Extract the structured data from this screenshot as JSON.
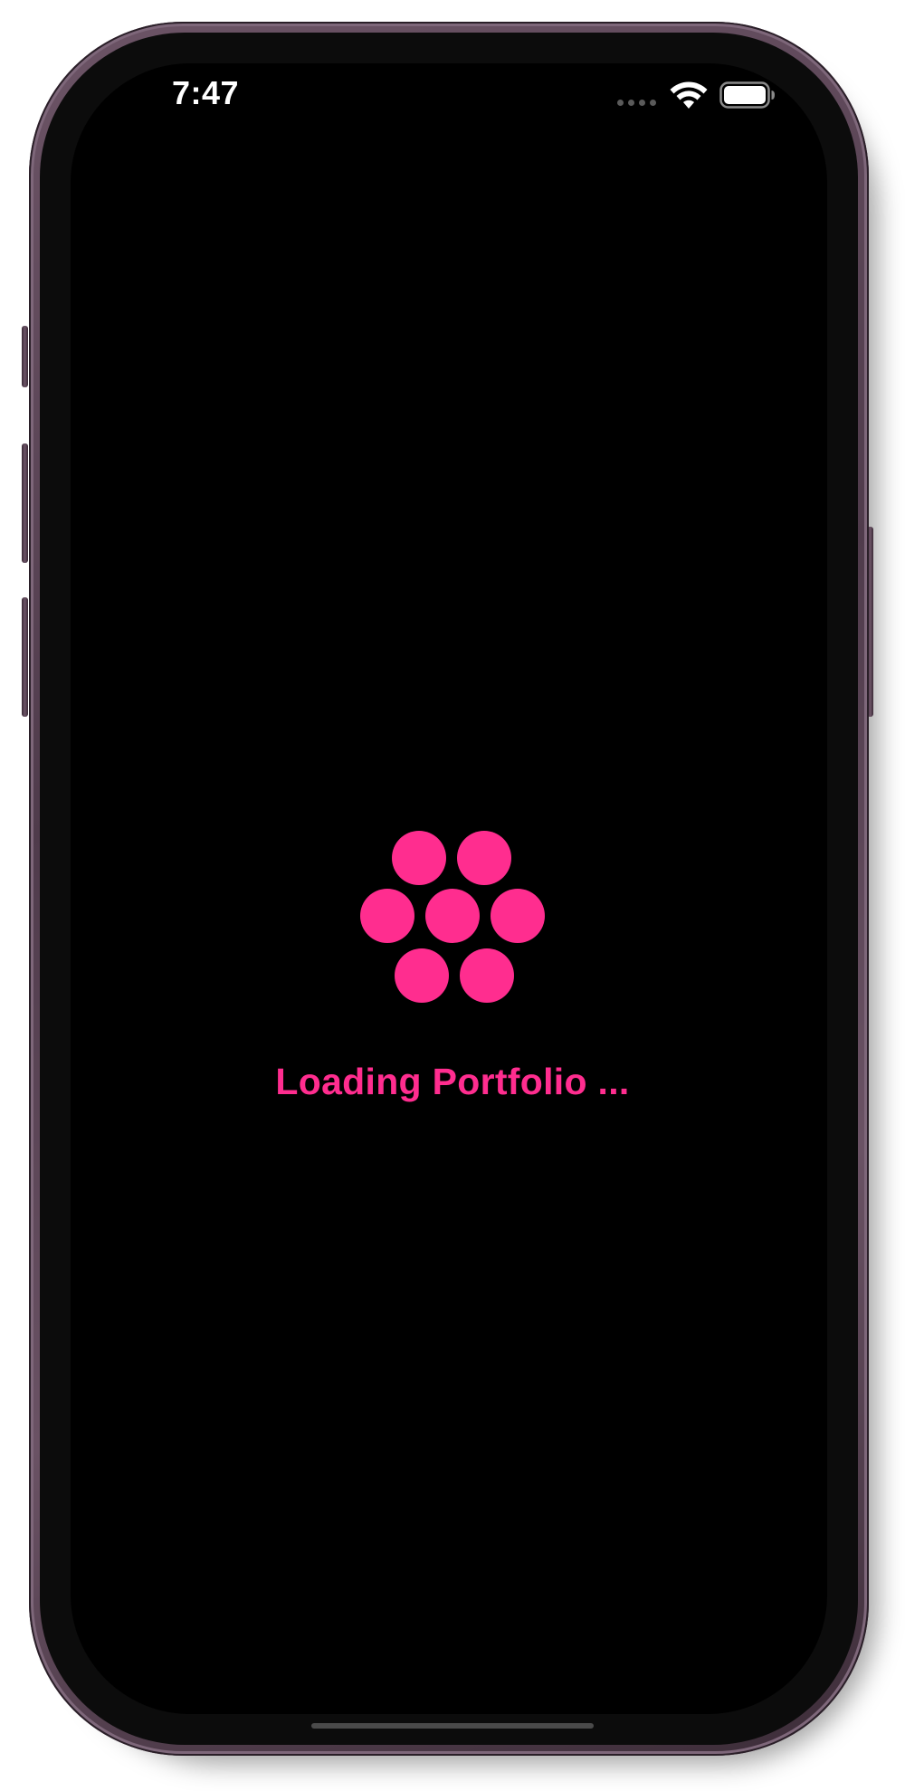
{
  "status_bar": {
    "time": "7:47",
    "signal_icon": "cellular-signal-icon",
    "wifi_icon": "wifi-icon",
    "battery_icon": "battery-icon"
  },
  "loader": {
    "icon": "loading-dots-icon",
    "message": "Loading Portfolio ..."
  },
  "colors": {
    "accent": "#ff2d8f",
    "background": "#000000",
    "frame": "#5b4558"
  }
}
